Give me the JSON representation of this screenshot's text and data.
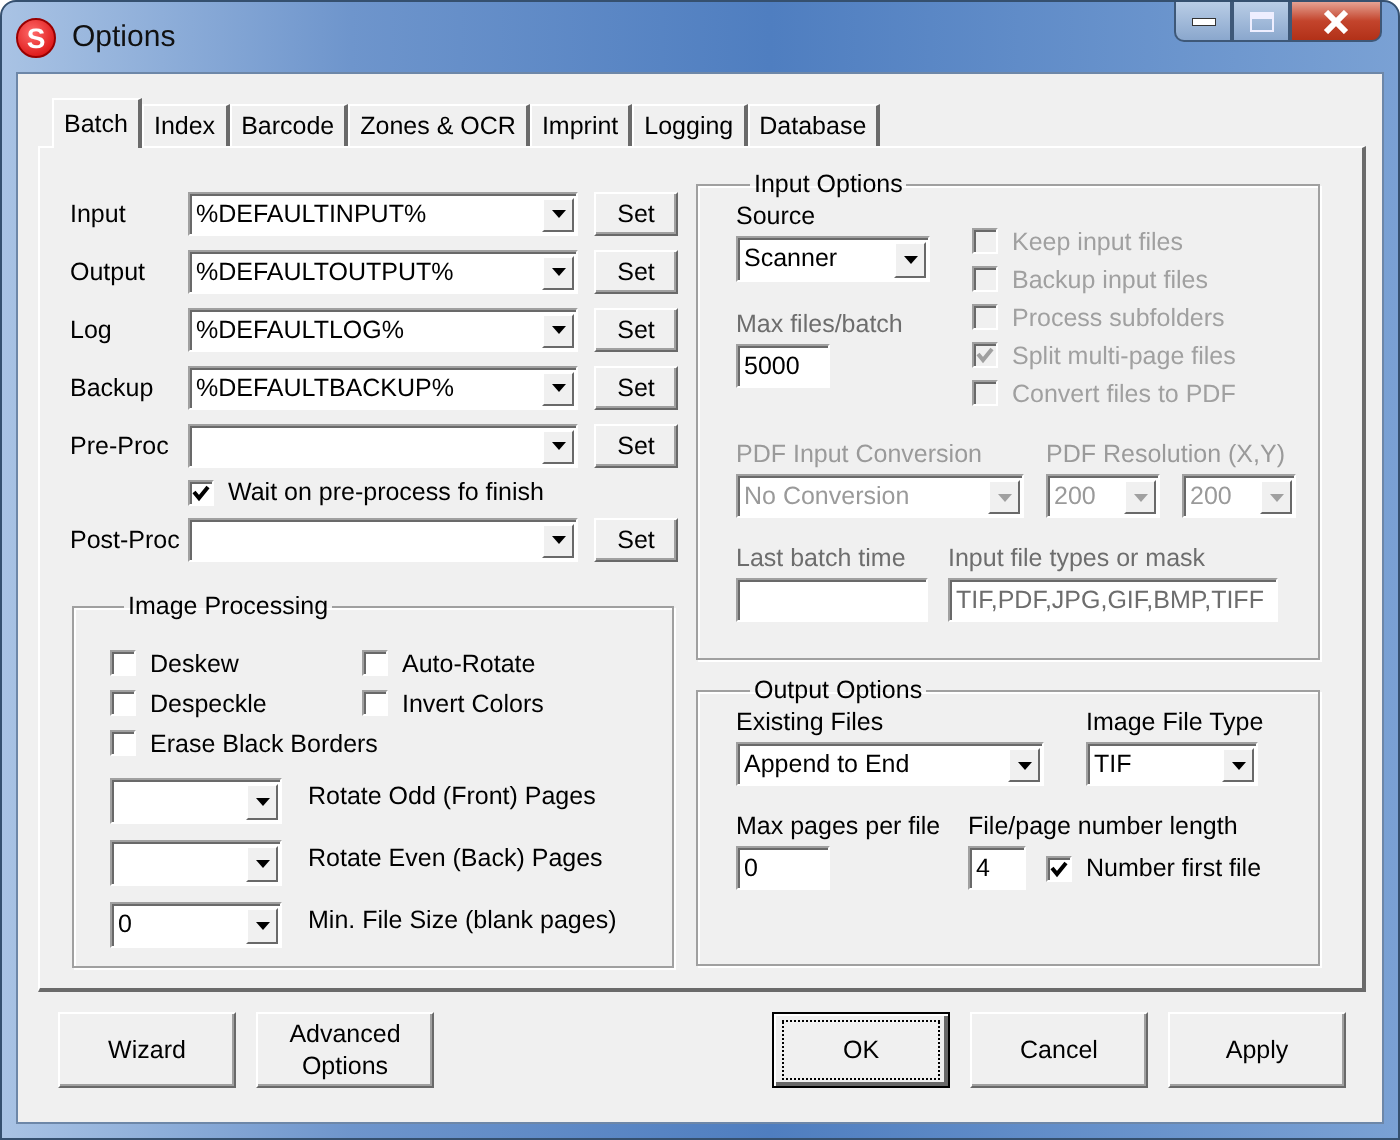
{
  "window": {
    "title": "Options",
    "icon_letter": "S"
  },
  "tabs": [
    {
      "label": "Batch",
      "selected": true
    },
    {
      "label": "Index",
      "selected": false
    },
    {
      "label": "Barcode",
      "selected": false
    },
    {
      "label": "Zones & OCR",
      "selected": false
    },
    {
      "label": "Imprint",
      "selected": false
    },
    {
      "label": "Logging",
      "selected": false
    },
    {
      "label": "Database",
      "selected": false
    }
  ],
  "paths": [
    {
      "kind": "path",
      "label": "Input",
      "value": "%DEFAULTINPUT%",
      "button": "Set"
    },
    {
      "kind": "path",
      "label": "Output",
      "value": "%DEFAULTOUTPUT%",
      "button": "Set"
    },
    {
      "kind": "path",
      "label": "Log",
      "value": "%DEFAULTLOG%",
      "button": "Set"
    },
    {
      "kind": "path",
      "label": "Backup",
      "value": "%DEFAULTBACKUP%",
      "button": "Set"
    },
    {
      "kind": "path",
      "label": "Pre-Proc",
      "button": "Set"
    },
    {
      "kind": "checkbox",
      "label": "Wait on pre-process fo finish",
      "checked": true
    },
    {
      "kind": "path",
      "label": "Post-Proc",
      "button": "Set"
    }
  ],
  "image_processing": {
    "title": "Image Processing",
    "checkboxes": [
      {
        "label": "Deskew",
        "checked": false
      },
      {
        "label": "Auto-Rotate",
        "checked": false
      },
      {
        "label": "Despeckle",
        "checked": false
      },
      {
        "label": "Invert Colors",
        "checked": false
      },
      {
        "label": "Erase Black Borders",
        "checked": false
      }
    ],
    "dropdowns": [
      {
        "label": "Rotate Odd (Front) Pages"
      },
      {
        "label": "Rotate Even (Back) Pages"
      },
      {
        "label": "Min. File Size (blank pages)",
        "value": "0"
      }
    ]
  },
  "input_options": {
    "title": "Input Options",
    "source": {
      "label": "Source",
      "value": "Scanner"
    },
    "max_files": {
      "label": "Max files/batch",
      "value": "5000"
    },
    "checkboxes": [
      {
        "label": "Keep input files",
        "checked": false,
        "disabled": true
      },
      {
        "label": "Backup input files",
        "checked": false,
        "disabled": true
      },
      {
        "label": "Process subfolders",
        "checked": false,
        "disabled": true
      },
      {
        "label": "Split multi-page files",
        "checked": true,
        "disabled": true
      },
      {
        "label": "Convert files to PDF",
        "checked": false,
        "disabled": true
      }
    ],
    "pdf_conversion": {
      "label": "PDF Input Conversion",
      "value": "No Conversion",
      "disabled": true
    },
    "pdf_resolution": {
      "label": "PDF Resolution (X,Y)",
      "values": [
        "200",
        "200"
      ],
      "disabled": true
    },
    "last_batch": {
      "label": "Last batch time"
    },
    "file_types": {
      "label": "Input file types or mask",
      "value": "TIF,PDF,JPG,GIF,BMP,TIFF"
    }
  },
  "output_options": {
    "title": "Output Options",
    "existing_files": {
      "label": "Existing Files",
      "value": "Append to End"
    },
    "image_type": {
      "label": "Image File Type",
      "value": "TIF"
    },
    "max_pages": {
      "label": "Max pages per file",
      "value": "0"
    },
    "number_length": {
      "label": "File/page number length",
      "value": "4"
    },
    "number_first": {
      "label": "Number first file",
      "checked": true
    }
  },
  "left_buttons": [
    {
      "label": "Wizard",
      "default": false
    },
    {
      "label": "Advanced Options",
      "default": false
    }
  ],
  "right_buttons": [
    {
      "label": "OK",
      "default": true
    },
    {
      "label": "Cancel",
      "default": false
    },
    {
      "label": "Apply",
      "default": false
    }
  ]
}
